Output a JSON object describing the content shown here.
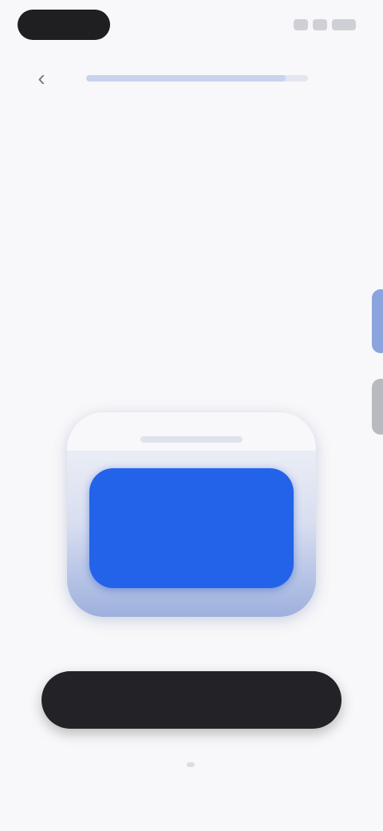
{
  "status_bar": {
    "icons": [
      "signal-icon",
      "wifi-icon",
      "battery-icon"
    ]
  },
  "nav": {
    "back_icon": "chevron-left-icon",
    "back_glyph": "‹",
    "progress_fraction": 0.9
  },
  "question": {
    "text": ""
  },
  "option": {
    "title": "",
    "description": ""
  },
  "continue_button": {
    "label": ""
  },
  "colors": {
    "accent": "#2263ea",
    "button": "#232327",
    "background": "#f8f8fa"
  }
}
